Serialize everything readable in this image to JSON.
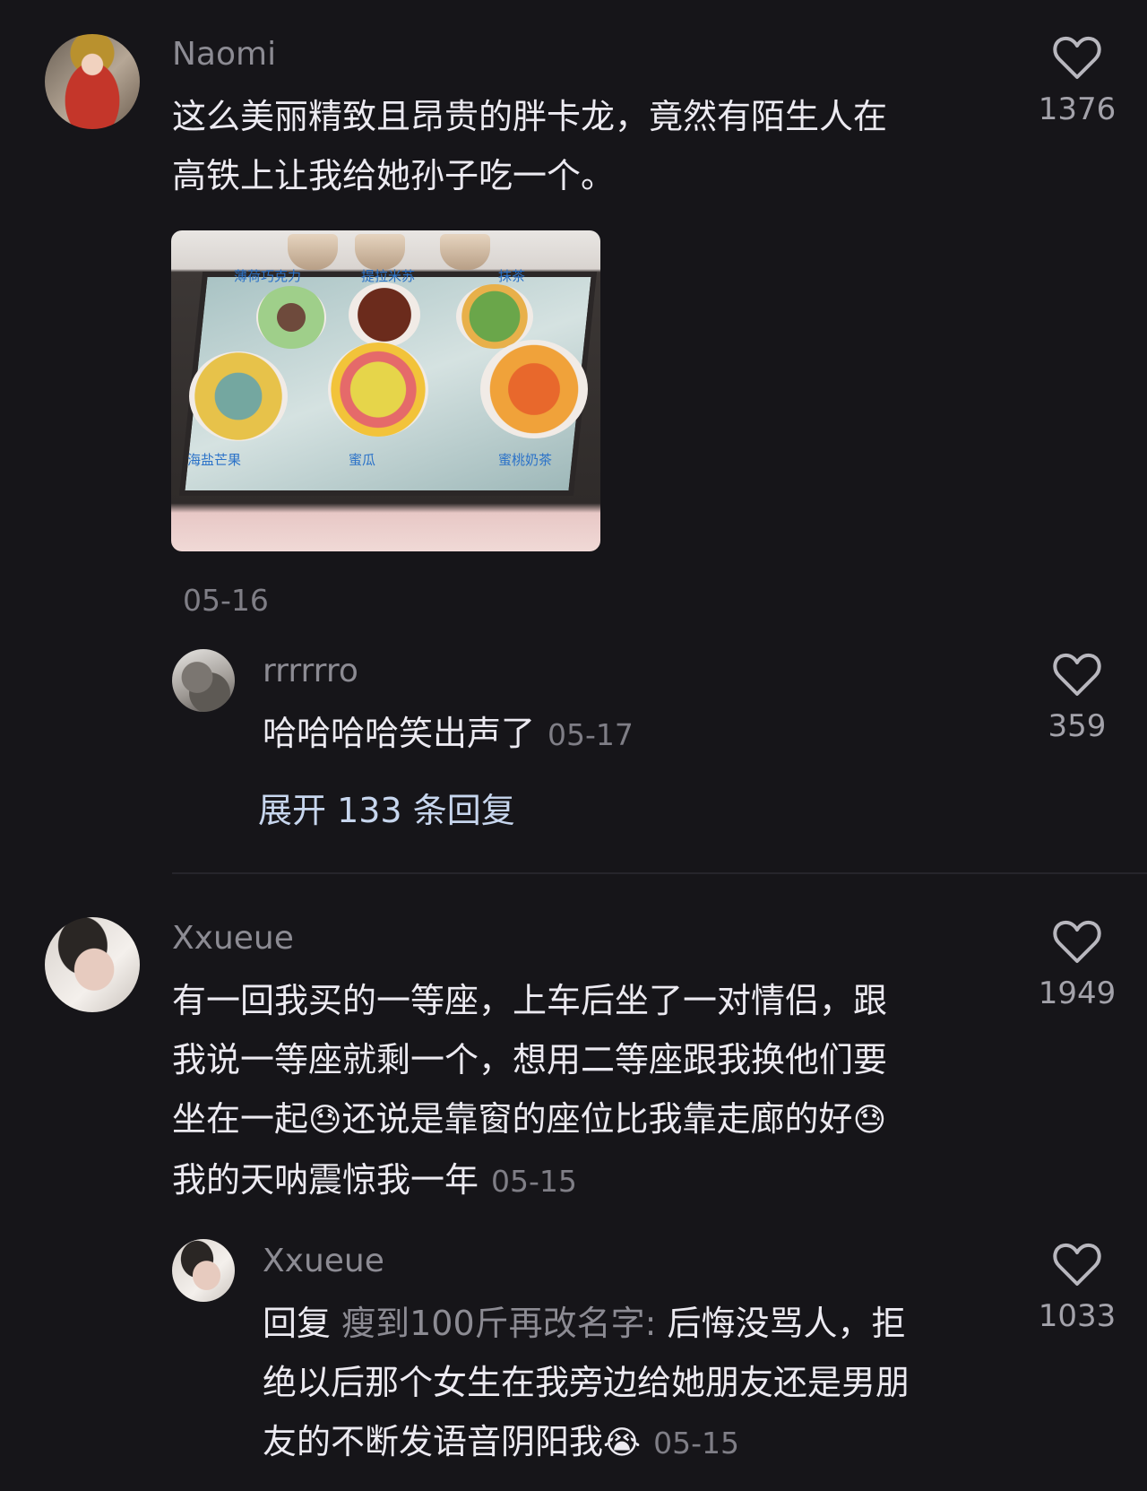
{
  "comments": [
    {
      "username": "Naomi",
      "lines": [
        "这么美丽精致且昂贵的胖卡龙，竟然有陌生人在",
        "高铁上让我给她孙子吃一个。"
      ],
      "date": "05-16",
      "likes": "1376",
      "image_labels": [
        "薄荷巧克力",
        "提拉米苏",
        "抹茶",
        "海盐芒果",
        "蜜瓜",
        "蜜桃奶茶"
      ],
      "reply": {
        "username": "rrrrrro",
        "text": "哈哈哈哈笑出声了",
        "date": "05-17",
        "likes": "359"
      },
      "expand_label": "展开 133 条回复"
    },
    {
      "username": "Xxueue",
      "lines": [
        "有一回我买的一等座，上车后坐了一对情侣，跟",
        "我说一等座就剩一个，想用二等座跟我换他们要",
        "坐在一起",
        "还说是靠窗的座位比我靠走廊的好",
        "我的天呐震惊我一年"
      ],
      "date": "05-15",
      "likes": "1949",
      "reply": {
        "username": "Xxueue",
        "reply_prefix": "回复",
        "reply_target": "瘦到100斤再改名字:",
        "lines": [
          "后悔没骂人，拒",
          "绝以后那个女生在我旁边给她朋友还是男朋",
          "友的不断发语音阴阳我"
        ],
        "date": "05-15",
        "likes": "1033"
      }
    }
  ],
  "icons": {
    "heart": "heart-outline-icon",
    "emoji_cry": "crying-emoji-icon",
    "emoji_sweat": "sweat-emoji-icon"
  }
}
